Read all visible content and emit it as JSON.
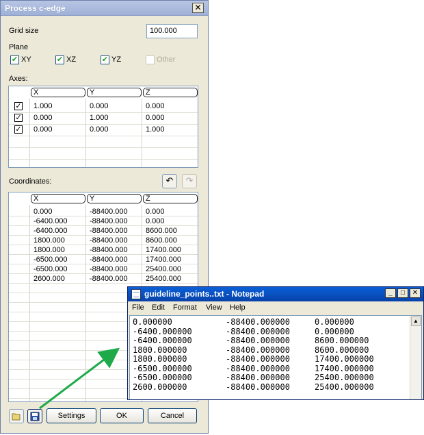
{
  "dialog": {
    "title": "Process c-edge",
    "close_glyph": "✕",
    "grid_size_label": "Grid size",
    "grid_size_value": "100.000",
    "plane_label": "Plane",
    "planes": [
      {
        "label": "XY",
        "checked": true,
        "enabled": true
      },
      {
        "label": "XZ",
        "checked": true,
        "enabled": true
      },
      {
        "label": "YZ",
        "checked": true,
        "enabled": true
      },
      {
        "label": "Other",
        "checked": false,
        "enabled": false
      }
    ],
    "axes_label": "Axes:",
    "axes_columns": [
      "X",
      "Y",
      "Z"
    ],
    "axes_rows": [
      {
        "checked": true,
        "x": "1.000",
        "y": "0.000",
        "z": "0.000"
      },
      {
        "checked": true,
        "x": "0.000",
        "y": "1.000",
        "z": "0.000"
      },
      {
        "checked": true,
        "x": "0.000",
        "y": "0.000",
        "z": "1.000"
      }
    ],
    "coordinates_label": "Coordinates:",
    "coord_columns": [
      "X",
      "Y",
      "Z"
    ],
    "coord_rows": [
      {
        "x": "0.000",
        "y": "-88400.000",
        "z": "0.000"
      },
      {
        "x": "-6400.000",
        "y": "-88400.000",
        "z": "0.000"
      },
      {
        "x": "-6400.000",
        "y": "-88400.000",
        "z": "8600.000"
      },
      {
        "x": "1800.000",
        "y": "-88400.000",
        "z": "8600.000"
      },
      {
        "x": "1800.000",
        "y": "-88400.000",
        "z": "17400.000"
      },
      {
        "x": "-6500.000",
        "y": "-88400.000",
        "z": "17400.000"
      },
      {
        "x": "-6500.000",
        "y": "-88400.000",
        "z": "25400.000"
      },
      {
        "x": "2600.000",
        "y": "-88400.000",
        "z": "25400.000"
      }
    ],
    "buttons": {
      "settings": "Settings",
      "ok": "OK",
      "cancel": "Cancel"
    },
    "icons": {
      "undo": "undo-icon",
      "redo": "redo-icon",
      "open": "open-folder-icon",
      "save": "save-disk-icon"
    }
  },
  "notepad": {
    "title": "guideline_points..txt - Notepad",
    "menu": [
      "File",
      "Edit",
      "Format",
      "View",
      "Help"
    ],
    "lines": [
      [
        "0.000000",
        "-88400.000000",
        "0.000000"
      ],
      [
        "-6400.000000",
        "-88400.000000",
        "0.000000"
      ],
      [
        "-6400.000000",
        "-88400.000000",
        "8600.000000"
      ],
      [
        "1800.000000",
        "-88400.000000",
        "8600.000000"
      ],
      [
        "1800.000000",
        "-88400.000000",
        "17400.000000"
      ],
      [
        "-6500.000000",
        "-88400.000000",
        "17400.000000"
      ],
      [
        "-6500.000000",
        "-88400.000000",
        "25400.000000"
      ],
      [
        "2600.000000",
        "-88400.000000",
        "25400.000000"
      ]
    ]
  },
  "colors": {
    "arrow": "#1faa4a",
    "checkmark": "#21a121",
    "dialog_bg": "#ece9d8",
    "notepad_title": "#0842a8"
  }
}
